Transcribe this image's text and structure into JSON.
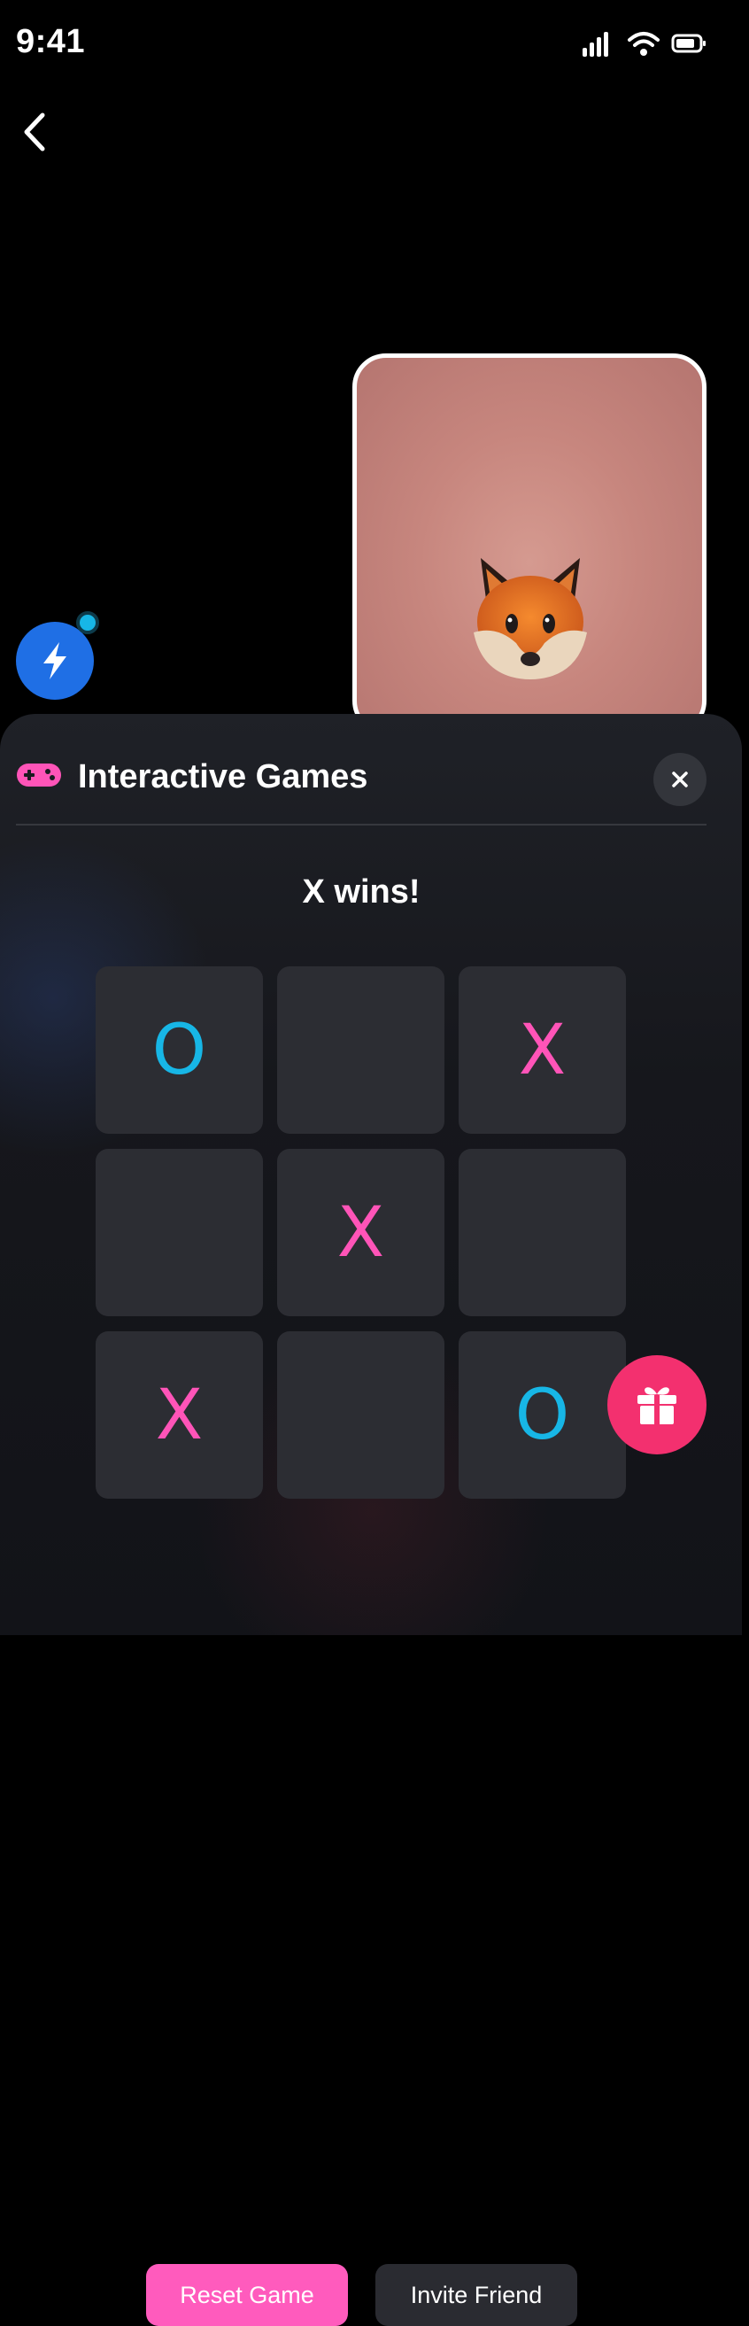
{
  "status_bar": {
    "time": "9:41",
    "icons": [
      "signal-icon",
      "wifi-icon",
      "battery-icon"
    ]
  },
  "nav": {
    "back_icon": "chevron-left-icon"
  },
  "self_view": {
    "avatar": "fox-emoji"
  },
  "quick_action": {
    "icon": "lightning-icon",
    "indicator_color": "#17b6e6",
    "color": "#1f6fe5"
  },
  "panel": {
    "icon": "gamepad-icon",
    "title": "Interactive Games",
    "close_icon": "close-icon",
    "game_status": "X wins!",
    "board": [
      [
        "O",
        "",
        "X"
      ],
      [
        "",
        "X",
        ""
      ],
      [
        "X",
        "",
        "O"
      ]
    ],
    "x_color": "#ff54b8",
    "o_color": "#17b6e6",
    "gift_icon": "gift-icon",
    "gift_color": "#f3306f",
    "reset_label": "Reset Game",
    "invite_label": "Invite Friend"
  }
}
